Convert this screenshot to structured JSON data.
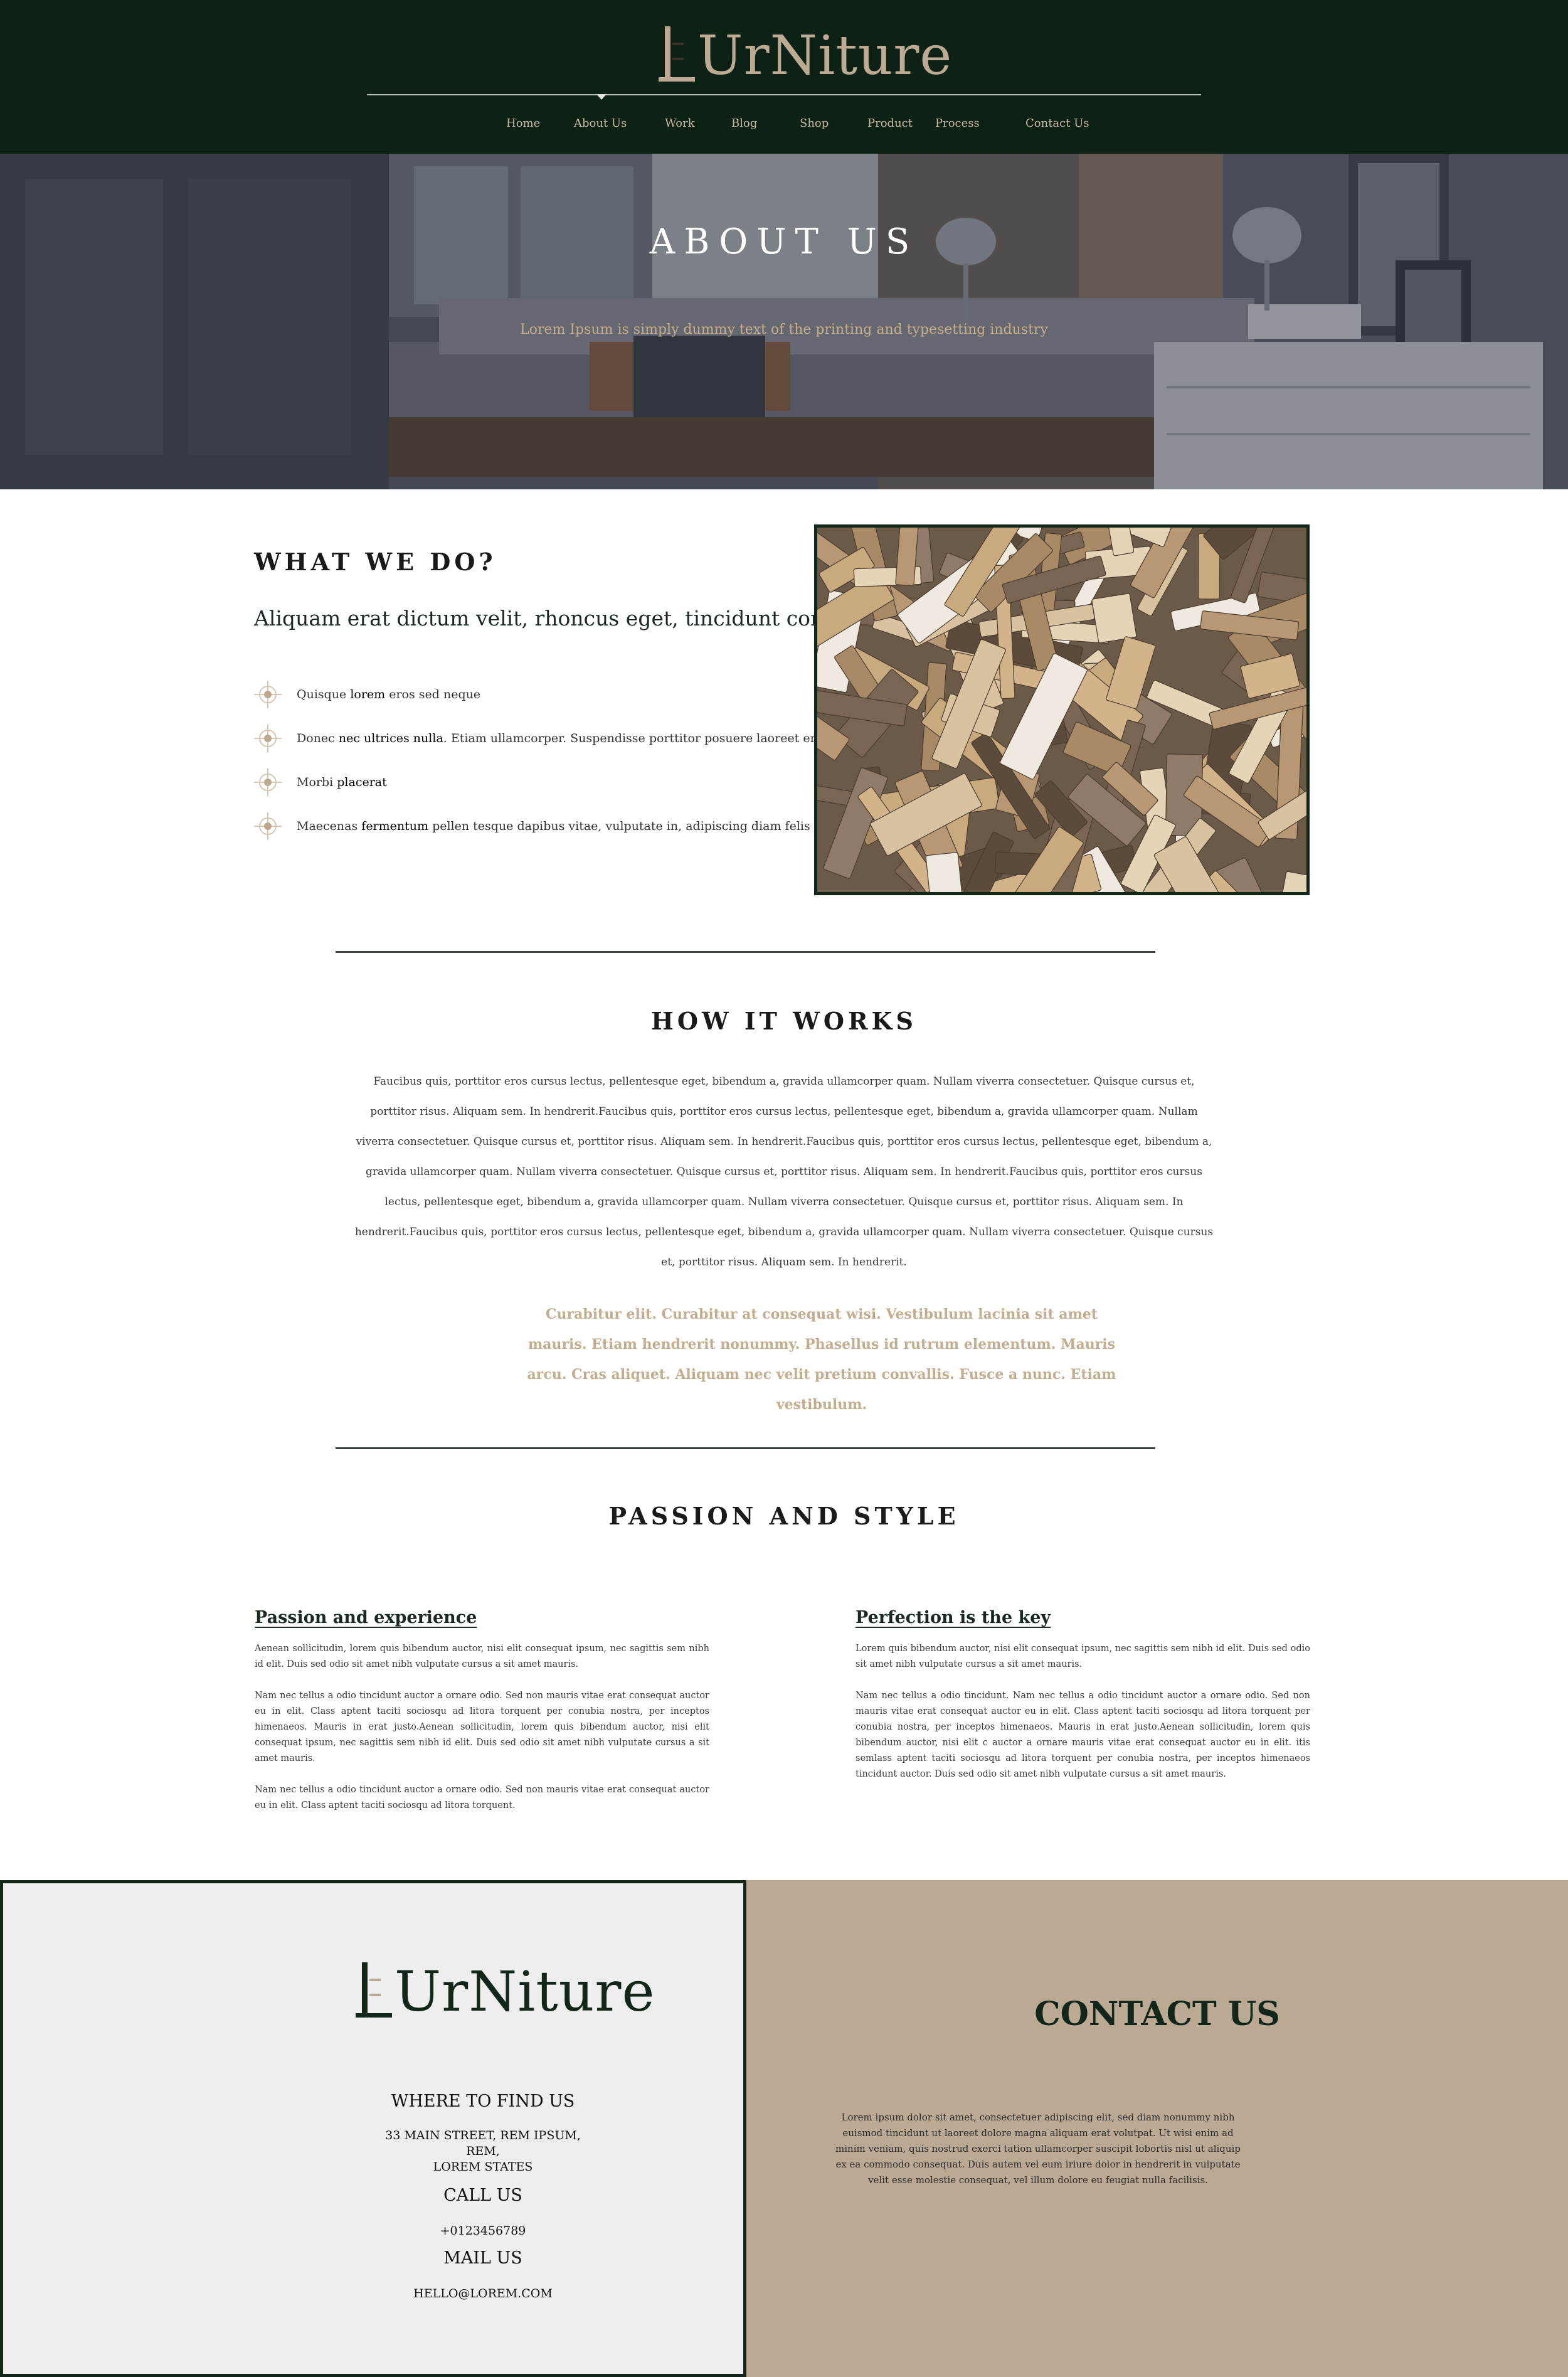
{
  "brand": {
    "logo_text": "UrNiture"
  },
  "nav": {
    "items": [
      "Home",
      "About Us",
      "Work",
      "Blog",
      "Shop",
      "Product",
      "Process",
      "Contact Us"
    ],
    "active": "About Us"
  },
  "hero": {
    "title": "ABOUT US",
    "subtitle": "Lorem Ipsum is simply dummy text of the printing and typesetting industry"
  },
  "what_we_do": {
    "title": "WHAT WE DO?",
    "lead": "Aliquam erat dictum velit, rhoncus eget, tincidunt congue.",
    "features": [
      {
        "pre": "Quisque ",
        "bold": "lorem",
        "post": " eros sed neque"
      },
      {
        "pre": "Donec ",
        "bold": "nec ultrices nulla",
        "post": ". Etiam ullamcorper. Suspendisse porttitor posuere laoreet enim"
      },
      {
        "pre": "Morbi ",
        "bold": "placerat",
        "post": ""
      },
      {
        "pre": "Maecenas ",
        "bold": "fermentum",
        "post": " pellen tesque dapibus vitae, vulputate in, adipiscing diam felis"
      }
    ],
    "image_name": "stacked-firewood-photo"
  },
  "how_it_works": {
    "title": "HOW IT WORKS",
    "body": "Faucibus quis, porttitor eros cursus lectus, pellentesque eget, bibendum a, gravida ullamcorper quam. Nullam viverra consectetuer. Quisque cursus et, porttitor risus. Aliquam sem. In hendrerit.Faucibus quis, porttitor eros cursus lectus, pellentesque eget, bibendum a, gravida ullamcorper quam. Nullam viverra consectetuer. Quisque cursus et, porttitor risus. Aliquam sem. In hendrerit.Faucibus quis, porttitor eros cursus lectus, pellentesque eget, bibendum a, gravida ullamcorper quam. Nullam viverra consectetuer. Quisque cursus et, porttitor risus. Aliquam sem. In hendrerit.Faucibus quis, porttitor eros cursus lectus, pellentesque eget, bibendum a, gravida ullamcorper quam. Nullam viverra consectetuer. Quisque cursus et, porttitor risus. Aliquam sem. In hendrerit.Faucibus quis, porttitor eros cursus lectus, pellentesque eget, bibendum a, gravida ullamcorper quam. Nullam viverra consectetuer. Quisque cursus et, porttitor risus. Aliquam sem. In hendrerit.",
    "quote": "Curabitur elit. Curabitur at consequat wisi. Vestibulum lacinia sit amet mauris. Etiam hendrerit nonummy. Phasellus id rutrum elementum. Mauris arcu. Cras aliquet. Aliquam nec velit pretium convallis. Fusce a nunc. Etiam vestibulum."
  },
  "passion": {
    "title": "PASSION AND STYLE",
    "left": {
      "heading": "Passion and experience",
      "paragraphs": [
        "Aenean sollicitudin, lorem quis bibendum auctor, nisi elit consequat ipsum, nec sagittis sem nibh id elit. Duis sed odio sit amet nibh vulputate cursus a sit amet mauris.",
        "Nam nec tellus a odio tincidunt auctor a ornare odio. Sed non mauris vitae erat consequat auctor eu in elit. Class aptent taciti sociosqu ad litora torquent per conubia nostra, per inceptos himenaeos. Mauris in erat justo.Aenean sollicitudin, lorem quis bibendum auctor, nisi elit consequat ipsum, nec sagittis sem nibh id elit. Duis sed odio sit amet nibh vulputate cursus a sit amet mauris.",
        "Nam nec tellus a odio tincidunt auctor a ornare odio. Sed non mauris vitae erat consequat auctor eu in elit. Class aptent taciti sociosqu ad litora torquent."
      ]
    },
    "right": {
      "heading": "Perfection is the key",
      "paragraphs": [
        "Lorem quis bibendum auctor, nisi elit consequat ipsum, nec sagittis sem nibh id elit. Duis sed odio sit amet nibh vulputate cursus a sit amet mauris.",
        "Nam nec tellus a odio tincidunt. Nam nec tellus a odio tincidunt auctor a ornare odio. Sed non mauris vitae erat consequat auctor eu in elit. Class aptent taciti sociosqu ad litora torquent per conubia nostra, per inceptos himenaeos. Mauris in erat justo.Aenean sollicitudin, lorem quis bibendum auctor, nisi elit c auctor a ornare mauris vitae erat consequat auctor eu in elit. itis semlass aptent taciti sociosqu ad litora torquent per conubia nostra, per inceptos himenaeos tincidunt auctor. Duis sed odio sit amet nibh vulputate cursus a sit amet mauris."
      ]
    }
  },
  "footer": {
    "find_heading": "WHERE TO FIND US",
    "address": [
      "33 MAIN STREET, REM IPSUM,",
      "REM,",
      "LOREM STATES"
    ],
    "call_heading": "CALL US",
    "phone": "+0123456789",
    "mail_heading": "MAIL  US",
    "email": "HELLO@LOREM.COM",
    "contact_title": "CONTACT US",
    "contact_text": "Lorem ipsum dolor sit amet, consectetuer adipiscing elit, sed diam nonummy nibh euismod tincidunt ut laoreet dolore magna aliquam erat volutpat. Ut wisi enim ad minim veniam, quis nostrud exerci tation ullamcorper suscipit lobortis nisl ut aliquip ex ea commodo consequat. Duis autem vel eum iriure dolor in hendrerit in vulputate velit esse molestie consequat, vel illum dolore eu feugiat nulla facilisis."
  },
  "colors": {
    "header_bg": "#0d2114",
    "accent_tan": "#bba993",
    "quote_text": "#c3ad8f",
    "footer_left_bg": "#eeeeee"
  }
}
